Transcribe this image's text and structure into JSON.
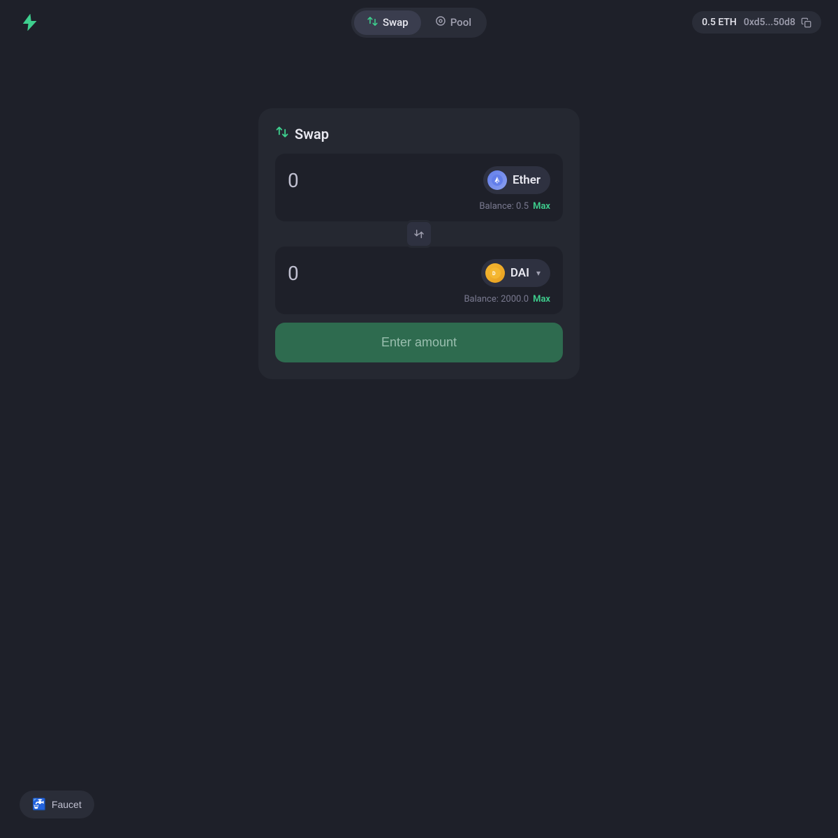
{
  "header": {
    "logo_icon": "⚡",
    "nav": {
      "swap_icon": "⇄",
      "swap_label": "Swap",
      "pool_icon": "◎",
      "pool_label": "Pool"
    },
    "wallet": {
      "balance": "0.5 ETH",
      "address": "0xd5...50d8"
    }
  },
  "swap_card": {
    "title_icon": "⇄",
    "title": "Swap",
    "from_token": {
      "amount": "0",
      "token_name": "Ether",
      "balance_label": "Balance: 0.5",
      "max_label": "Max"
    },
    "to_token": {
      "amount": "0",
      "token_name": "DAI",
      "balance_label": "Balance: 2000.0",
      "max_label": "Max"
    },
    "swap_arrow": "↓↑",
    "enter_amount_label": "Enter amount"
  },
  "faucet": {
    "icon": "🚰",
    "label": "Faucet"
  }
}
